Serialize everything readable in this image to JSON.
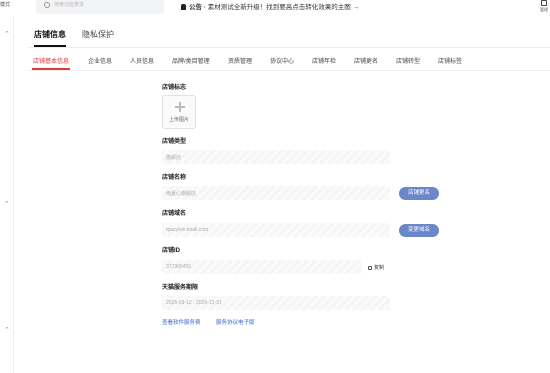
{
  "topbar": {
    "left_text": "模式",
    "search_placeholder": "搜索功能菜单",
    "notice_prefix": "公告 · ",
    "notice_text": "素材测试全新升级！找到要高点击转化效果的主图 →",
    "right_label": "管理"
  },
  "tabs_primary": [
    {
      "label": "店铺信息",
      "active": true
    },
    {
      "label": "隐私保护",
      "active": false
    }
  ],
  "tabs_secondary": [
    {
      "label": "店铺基本信息",
      "active": true
    },
    {
      "label": "企业信息",
      "active": false
    },
    {
      "label": "人员信息",
      "active": false
    },
    {
      "label": "品牌/类目管理",
      "active": false
    },
    {
      "label": "资质管理",
      "active": false
    },
    {
      "label": "协议中心",
      "active": false
    },
    {
      "label": "店铺年检",
      "active": false
    },
    {
      "label": "店铺更名",
      "active": false
    },
    {
      "label": "店铺转型",
      "active": false
    },
    {
      "label": "店铺标签",
      "active": false
    }
  ],
  "form": {
    "logo_label": "店铺标志",
    "upload_text": "上传图片",
    "type_label": "店铺类型",
    "type_value": "旗舰店",
    "name_label": "店铺名称",
    "name_value": "雨夏心旗舰店",
    "rename_button": "店铺更名",
    "domain_label": "店铺域名",
    "domain_value": "qiaoyixin.tmall.com",
    "change_domain_button": "变更域名",
    "id_label": "店铺ID",
    "id_value": "377366455",
    "copy_label": "复制",
    "service_label": "天猫服务期限",
    "service_value": "2025-09-12 - 2026-12-31",
    "link_software": "查看软件服务费",
    "link_agreement": "服务协议电子版"
  }
}
